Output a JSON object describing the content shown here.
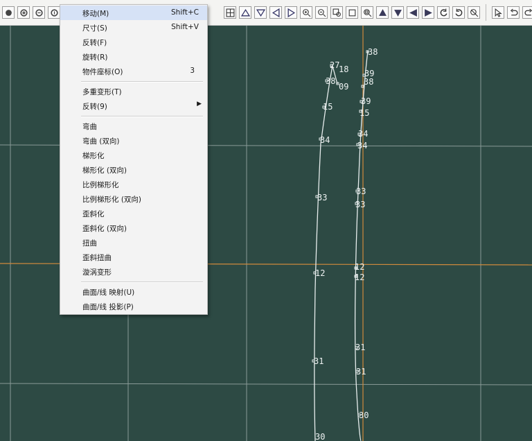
{
  "toolbar": {
    "left_icons": [
      "circle-button-icon",
      "circle-button-icon",
      "circle-button-icon",
      "circle-button-icon"
    ],
    "right_icons": [
      "grid-icon",
      "triangle-up-icon",
      "triangle-down-icon",
      "triangle-left-icon",
      "triangle-right-icon",
      "zoom-in-icon",
      "zoom-out-icon",
      "zoom-window-icon",
      "rectangle-icon",
      "zoom-fit-icon",
      "arrow-up-icon",
      "arrow-down-icon",
      "arrow-left-icon",
      "arrow-right-icon",
      "rotate-left-icon",
      "rotate-right-icon",
      "zoom-all-icon",
      "select-pointer-icon",
      "undo-icon",
      "redo-icon"
    ]
  },
  "menu": {
    "items": [
      {
        "label": "移动(M)",
        "shortcut": "Shift+C",
        "highlighted": true
      },
      {
        "label": "尺寸(S)",
        "shortcut": "Shift+V"
      },
      {
        "label": "反转(F)"
      },
      {
        "label": "旋转(R)"
      },
      {
        "label": "物件座标(O)",
        "shortcut": "3"
      },
      {
        "label": "多重变形(T)"
      },
      {
        "label": "反转(9)",
        "submenu": true
      },
      {
        "label": "弯曲"
      },
      {
        "label": "弯曲 (双向)"
      },
      {
        "label": "梯形化"
      },
      {
        "label": "梯形化 (双向)"
      },
      {
        "label": "比例梯形化"
      },
      {
        "label": "比例梯形化 (双向)"
      },
      {
        "label": "歪斜化"
      },
      {
        "label": "歪斜化 (双向)"
      },
      {
        "label": "扭曲"
      },
      {
        "label": "歪斜扭曲"
      },
      {
        "label": "漩涡变形"
      },
      {
        "label": "曲面/线 映射(U)"
      },
      {
        "label": "曲面/线 投影(P)"
      }
    ]
  },
  "viewport": {
    "background": "#2d4a44",
    "grid_color": "#9aa9a6",
    "axis_color": "#d08a3c",
    "curve_color": "#e8eeee",
    "point_labels": [
      "27",
      "18",
      "38",
      "09",
      "15",
      "34",
      "33",
      "12",
      "31",
      "30",
      "38",
      "39",
      "38",
      "39",
      "15",
      "34",
      "34",
      "33",
      "33",
      "12",
      "12",
      "31",
      "31",
      "30"
    ]
  }
}
